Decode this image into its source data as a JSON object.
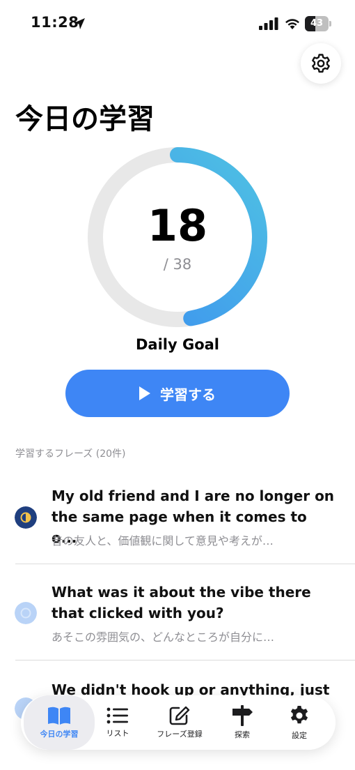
{
  "status_bar": {
    "time": "11:28",
    "battery": "43"
  },
  "page": {
    "title": "今日の学習"
  },
  "progress": {
    "count": "18",
    "total_text": "/ 38",
    "completed": 18,
    "goal": 38,
    "goal_label": "Daily Goal"
  },
  "study_button": {
    "label": "学習する"
  },
  "phrases": {
    "header": "学習するフレーズ (20件)",
    "items": [
      {
        "english": "My old friend and I are no longer on the same page when it comes to o...",
        "japanese": "昔の友人と、価値観に関して意見や考えが…",
        "status": "half"
      },
      {
        "english": "What was it about the vibe there that clicked with you?",
        "japanese": "あそこの雰囲気の、どんなところが自分に…",
        "status": "new"
      },
      {
        "english": "We didn't hook up or anything, just",
        "japanese": "",
        "status": "new"
      }
    ]
  },
  "tab_bar": {
    "tabs": [
      {
        "label": "今日の学習",
        "icon": "book-icon",
        "active": true
      },
      {
        "label": "リスト",
        "icon": "list-icon",
        "active": false
      },
      {
        "label": "フレーズ登録",
        "icon": "compose-icon",
        "active": false
      },
      {
        "label": "探索",
        "icon": "signpost-icon",
        "active": false
      },
      {
        "label": "設定",
        "icon": "gear-icon",
        "active": false
      }
    ]
  },
  "colors": {
    "accent": "#3e86f5",
    "ring_start": "#3b8ff0",
    "ring_end": "#4fc1e3",
    "ring_track": "#e8e8e8",
    "half_dot": "#1f3f7f",
    "new_dot": "#b9d3f7"
  }
}
